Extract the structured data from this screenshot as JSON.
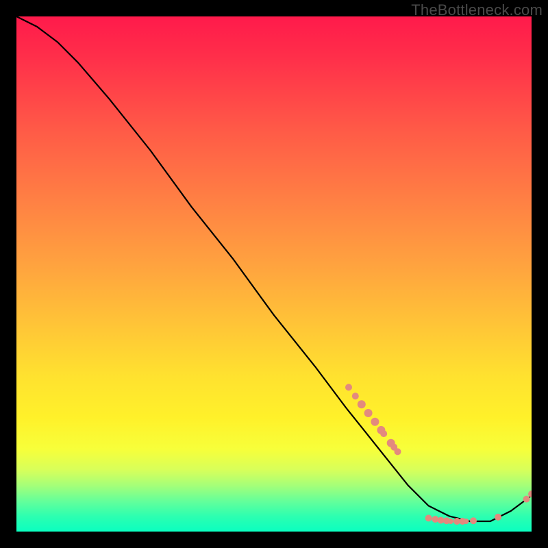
{
  "watermark": {
    "text": "TheBottleneck.com"
  },
  "colors": {
    "marker": "#e38a7e",
    "line": "#000000"
  },
  "chart_data": {
    "type": "line",
    "title": "",
    "xlabel": "",
    "ylabel": "",
    "xlim": [
      0,
      100
    ],
    "ylim": [
      0,
      100
    ],
    "grid": false,
    "legend": false,
    "series": [
      {
        "name": "curve",
        "x": [
          0,
          4,
          8,
          12,
          18,
          26,
          34,
          42,
          50,
          58,
          64,
          68,
          72,
          76,
          80,
          84,
          88,
          92,
          96,
          100
        ],
        "y": [
          100,
          98,
          95,
          91,
          84,
          74,
          63,
          53,
          42,
          32,
          24,
          19,
          14,
          9,
          5,
          3,
          2,
          2,
          4,
          7
        ]
      }
    ],
    "markers": [
      {
        "x": 64.5,
        "y": 28.0,
        "r": 5
      },
      {
        "x": 65.8,
        "y": 26.3,
        "r": 5
      },
      {
        "x": 67.0,
        "y": 24.7,
        "r": 6
      },
      {
        "x": 68.3,
        "y": 23.0,
        "r": 6
      },
      {
        "x": 69.6,
        "y": 21.3,
        "r": 6
      },
      {
        "x": 70.8,
        "y": 19.7,
        "r": 6
      },
      {
        "x": 71.3,
        "y": 19.0,
        "r": 5
      },
      {
        "x": 72.7,
        "y": 17.2,
        "r": 6
      },
      {
        "x": 73.3,
        "y": 16.4,
        "r": 5
      },
      {
        "x": 74.0,
        "y": 15.5,
        "r": 5
      },
      {
        "x": 80.0,
        "y": 2.6,
        "r": 5
      },
      {
        "x": 81.3,
        "y": 2.4,
        "r": 5
      },
      {
        "x": 82.4,
        "y": 2.2,
        "r": 5
      },
      {
        "x": 83.5,
        "y": 2.1,
        "r": 5
      },
      {
        "x": 84.3,
        "y": 2.0,
        "r": 4
      },
      {
        "x": 85.5,
        "y": 2.0,
        "r": 5
      },
      {
        "x": 86.6,
        "y": 2.0,
        "r": 5
      },
      {
        "x": 87.3,
        "y": 2.0,
        "r": 4
      },
      {
        "x": 88.7,
        "y": 2.1,
        "r": 5
      },
      {
        "x": 93.5,
        "y": 2.8,
        "r": 5
      },
      {
        "x": 99.0,
        "y": 6.3,
        "r": 5
      },
      {
        "x": 100.0,
        "y": 7.3,
        "r": 5
      }
    ]
  }
}
